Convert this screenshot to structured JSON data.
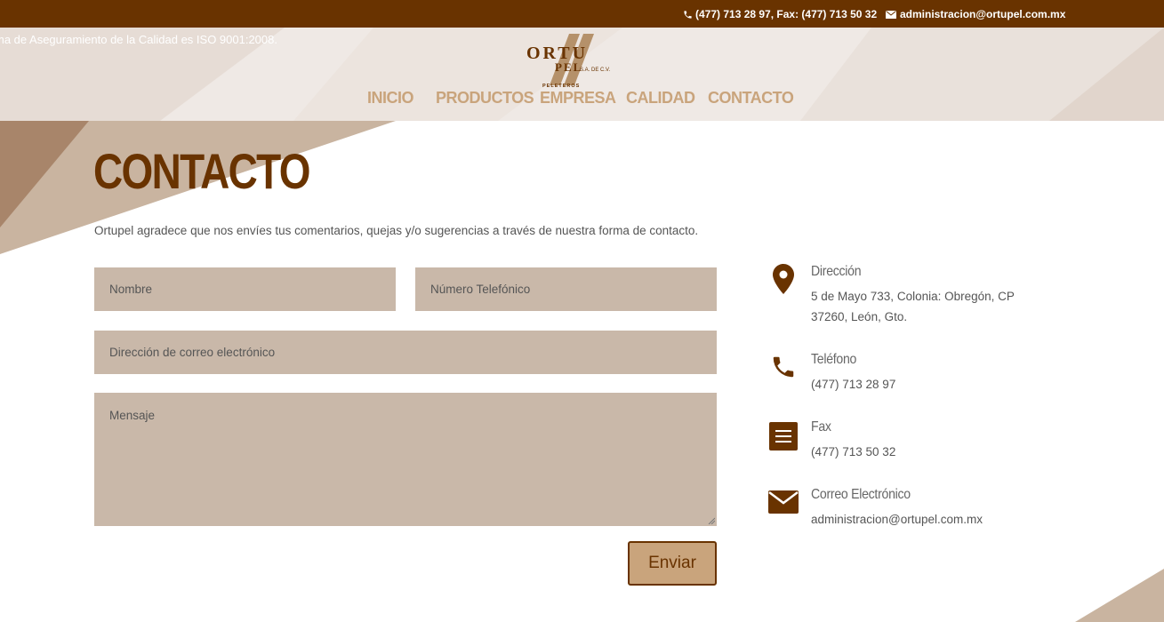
{
  "topbar": {
    "phone_text": "(477) 713 28 97, Fax: (477) 713 50 32",
    "email_text": "administracion@ortupel.com.mx",
    "icons": {
      "phone": "phone-icon",
      "email": "envelope-icon"
    }
  },
  "header": {
    "ticker": "ma de Aseguramiento de la Calidad es ISO 9001:2008.",
    "logo": {
      "line1": "ORTU",
      "line2": "PEL",
      "suffix": "S.A. DE C.V.",
      "tagline": "PELETEROS"
    }
  },
  "nav": {
    "items": [
      "INICIO",
      "PRODUCTOS",
      "EMPRESA",
      "CALIDAD",
      "CONTACTO"
    ]
  },
  "page": {
    "title": "CONTACTO",
    "intro": "Ortupel agradece que nos envíes tus comentarios, quejas y/o sugerencias a través de nuestra forma de contacto."
  },
  "form": {
    "name_placeholder": "Nombre",
    "phone_placeholder": "Número Telefónico",
    "email_placeholder": "Dirección de correo electrónico",
    "message_placeholder": "Mensaje",
    "submit_label": "Enviar"
  },
  "contact_info": {
    "address": {
      "label": "Dirección",
      "value": "5 de Mayo 733, Colonia: Obregón, CP 37260, León, Gto.",
      "icon": "map-pin-icon"
    },
    "phone": {
      "label": "Teléfono",
      "value": "(477) 713 28 97",
      "icon": "phone-icon"
    },
    "fax": {
      "label": "Fax",
      "value": "(477) 713 50 32",
      "icon": "menu-icon"
    },
    "email": {
      "label": "Correo Electrónico",
      "value": "administracion@ortupel.com.mx",
      "icon": "envelope-icon"
    }
  },
  "colors": {
    "brand_dark": "#693300",
    "accent_tan": "#c9a47c",
    "field_bg": "#c9b8a9",
    "header_bg": "#efe9e5"
  }
}
